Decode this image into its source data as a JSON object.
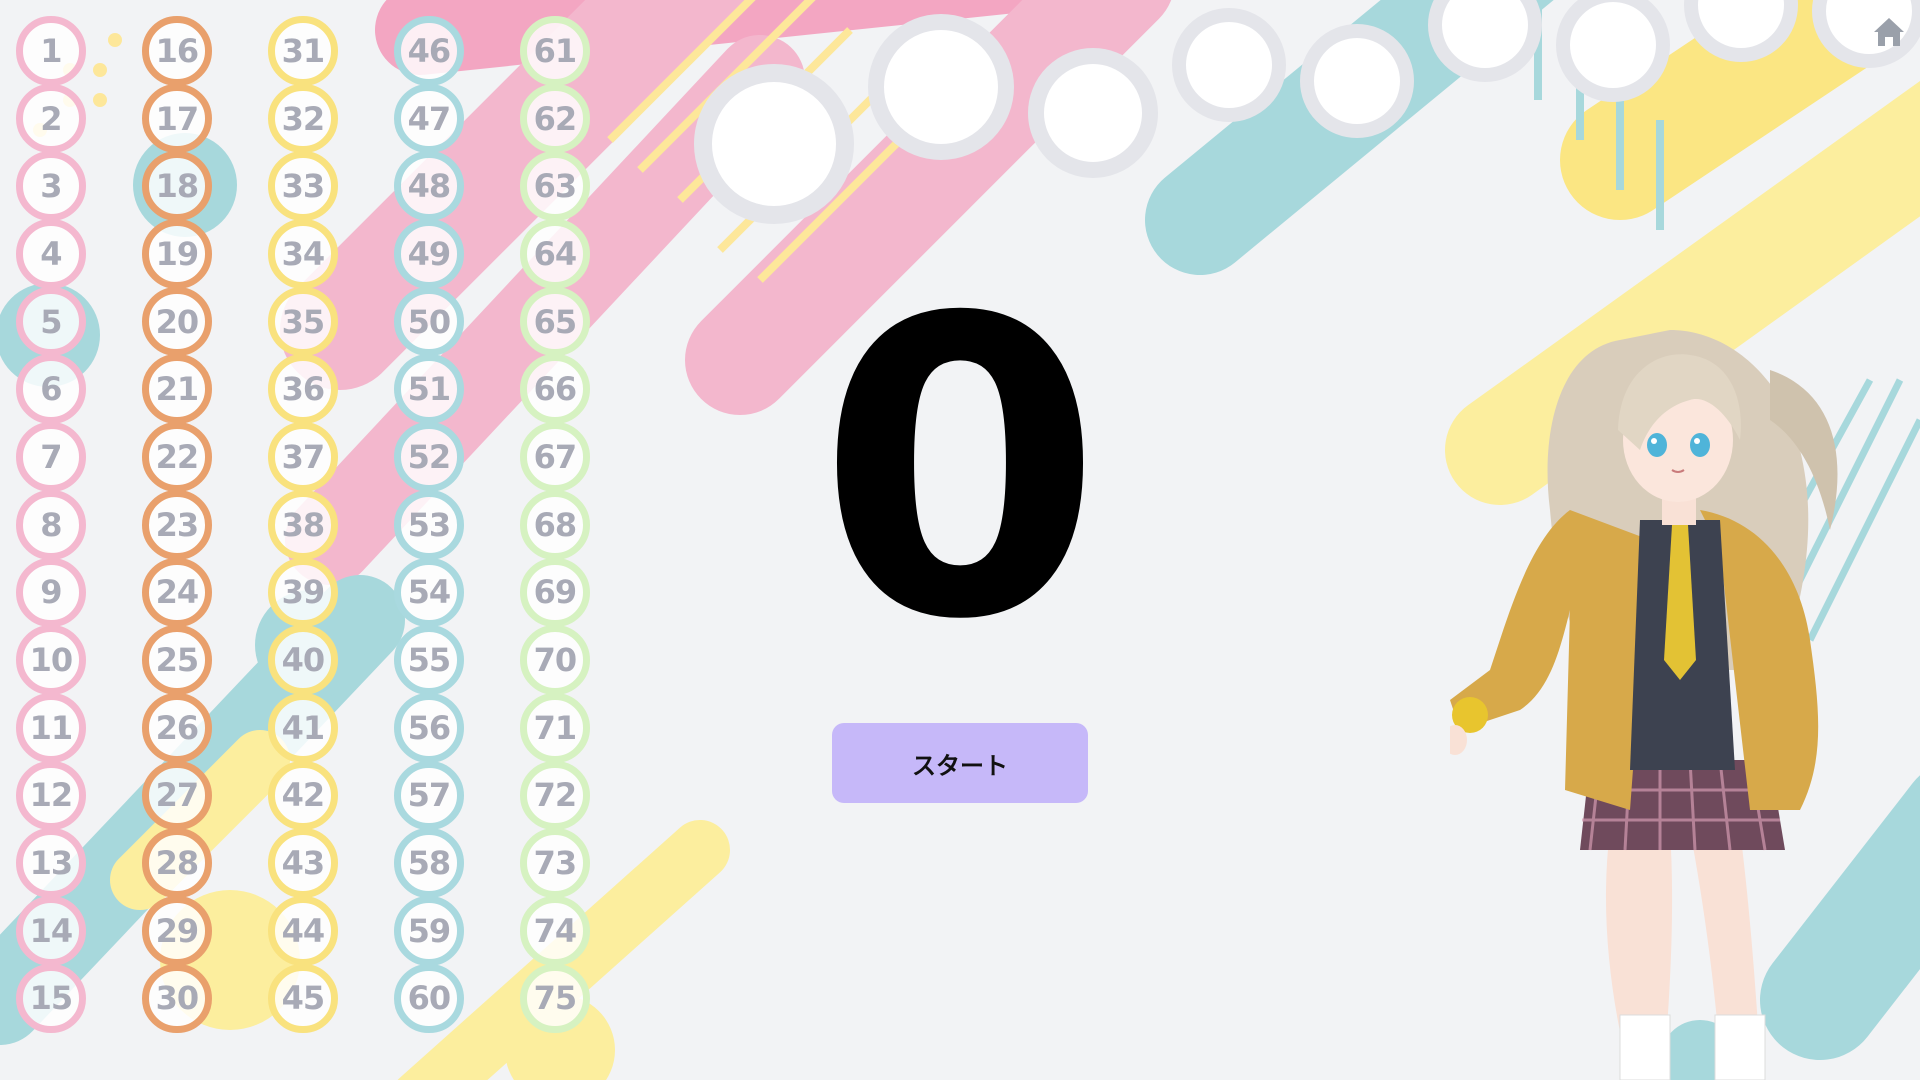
{
  "current_number": "0",
  "start_button_label": "スタート",
  "home_icon": "home-icon",
  "columns": [
    {
      "ring_color": "#f4b8cf",
      "numbers": [
        "1",
        "2",
        "3",
        "4",
        "5",
        "6",
        "7",
        "8",
        "9",
        "10",
        "11",
        "12",
        "13",
        "14",
        "15"
      ]
    },
    {
      "ring_color": "#e9a06c",
      "numbers": [
        "16",
        "17",
        "18",
        "19",
        "20",
        "21",
        "22",
        "23",
        "24",
        "25",
        "26",
        "27",
        "28",
        "29",
        "30"
      ]
    },
    {
      "ring_color": "#f9e27e",
      "numbers": [
        "31",
        "32",
        "33",
        "34",
        "35",
        "36",
        "37",
        "38",
        "39",
        "40",
        "41",
        "42",
        "43",
        "44",
        "45"
      ]
    },
    {
      "ring_color": "#a9d9df",
      "numbers": [
        "46",
        "47",
        "48",
        "49",
        "50",
        "51",
        "52",
        "53",
        "54",
        "55",
        "56",
        "57",
        "58",
        "59",
        "60"
      ]
    },
    {
      "ring_color": "#d6f2c1",
      "numbers": [
        "61",
        "62",
        "63",
        "64",
        "65",
        "66",
        "67",
        "68",
        "69",
        "70",
        "71",
        "72",
        "73",
        "74",
        "75"
      ]
    }
  ],
  "colors": {
    "background": "#f2f3f5",
    "accent_pink": "#f3b7cd",
    "accent_teal": "#a7d8dc",
    "accent_yellow": "#fcee9e",
    "button": "#c6b8f9"
  }
}
